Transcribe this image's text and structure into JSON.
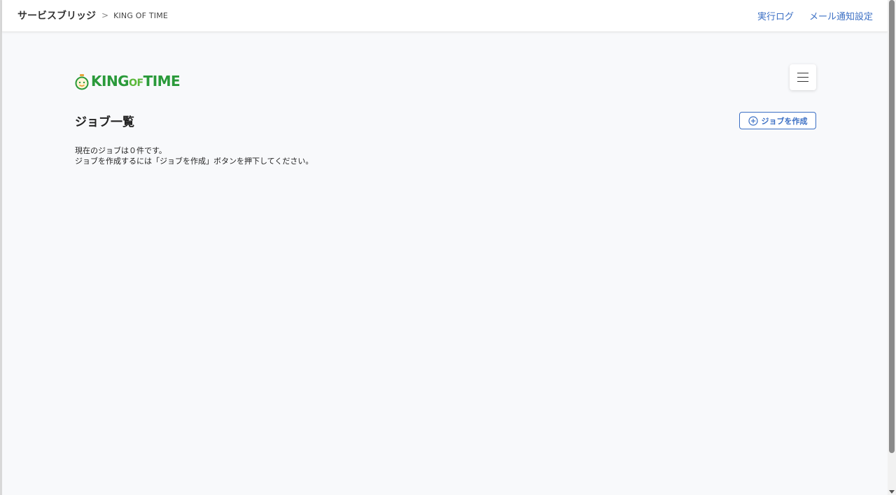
{
  "header": {
    "breadcrumb_root": "サービスブリッジ",
    "breadcrumb_separator": ">",
    "breadcrumb_current": "KING OF TIME",
    "links": [
      "実行ログ",
      "メール通知設定"
    ]
  },
  "logo": {
    "text_king": "KING",
    "text_of": "OF",
    "text_time": "TIME",
    "color": "#2a9a3a"
  },
  "main": {
    "title": "ジョブ一覧",
    "create_button_label": "ジョブを作成",
    "empty_message_line1": "現在のジョブは０件です。",
    "empty_message_line2": "ジョブを作成するには「ジョブを作成」ボタンを押下してください。"
  },
  "icons": {
    "menu": "hamburger-icon",
    "create": "plus-circle-icon",
    "logo": "clock-face-icon"
  },
  "colors": {
    "link": "#3b6fc4",
    "background": "#f8f9fb"
  }
}
